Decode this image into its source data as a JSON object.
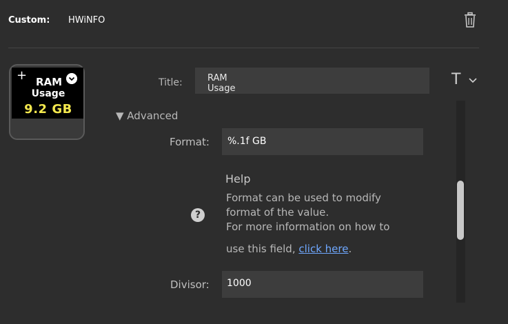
{
  "header": {
    "custom_label": "Custom:",
    "plugin_name": "HWiNFO"
  },
  "key_preview": {
    "plus": "+",
    "line1": "RAM",
    "line2": "Usage",
    "value": "9.2 GB",
    "value_color": "#f4e84e"
  },
  "title_field": {
    "label": "Title:",
    "value_line1": "RAM",
    "value_line2": "Usage"
  },
  "font_button": {
    "label": "T"
  },
  "advanced": {
    "label": "▼ Advanced"
  },
  "format_field": {
    "label": "Format:",
    "value": "%.1f GB"
  },
  "help": {
    "title": "Help",
    "line1": "Format can be used to modify",
    "line2": "format of the value.",
    "line3": "For more information on how to",
    "line4_prefix": "use this field,",
    "link_text": "click here",
    "line4_suffix": ".",
    "icon_glyph": "?"
  },
  "divisor_field": {
    "label": "Divisor:",
    "value": "1000"
  },
  "icons": {
    "trash": "trash-icon",
    "chevron": "chevron-down-icon",
    "help": "help-icon"
  }
}
